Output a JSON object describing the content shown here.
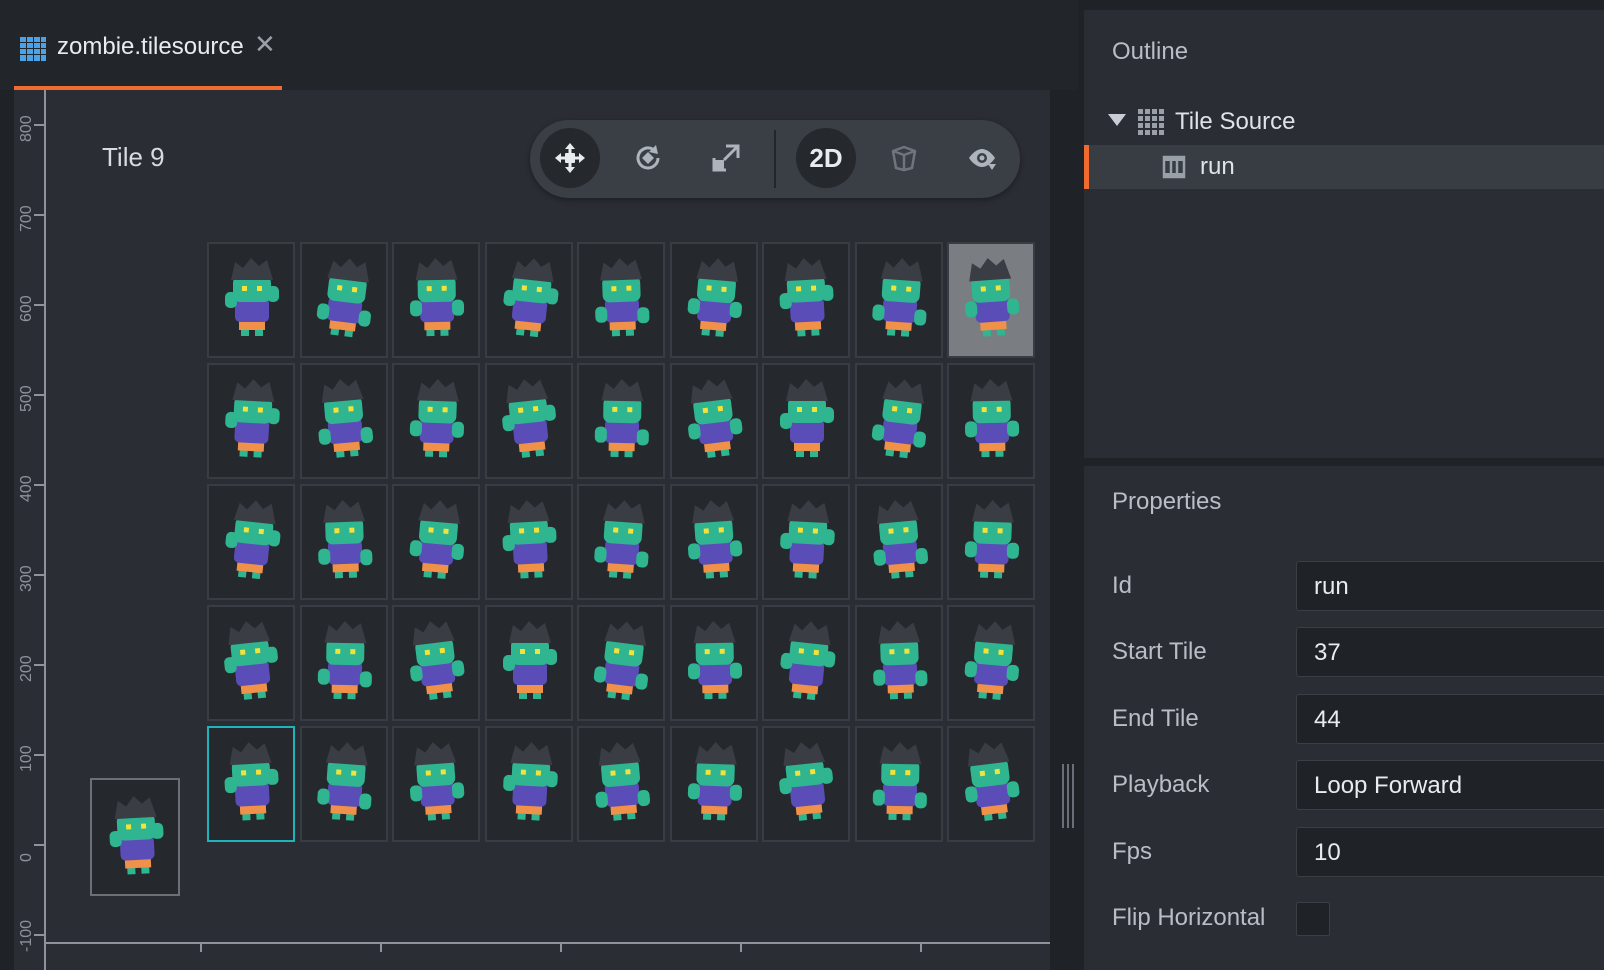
{
  "tab": {
    "title": "zombie.tilesource",
    "icon": "grid-icon"
  },
  "scene": {
    "tile_label": "Tile 9",
    "ruler_ticks": [
      "800",
      "700",
      "600",
      "500",
      "400",
      "300",
      "200",
      "100",
      "0",
      "-100"
    ],
    "toolbar": {
      "mode_2d_label": "2D",
      "tools": [
        "move-icon",
        "rotate-icon",
        "scale-icon",
        "2d-toggle",
        "perspective-cube-icon",
        "visibility-filter-icon"
      ]
    },
    "grid": {
      "rows": 5,
      "cols": 9,
      "hover_tile": 9,
      "selected_tile": 37
    }
  },
  "outline": {
    "title": "Outline",
    "root": {
      "label": "Tile Source",
      "icon": "tilesource-grid-icon"
    },
    "child": {
      "label": "run",
      "icon": "animation-filmstrip-icon"
    }
  },
  "properties": {
    "title": "Properties",
    "fields": [
      {
        "label": "Id",
        "value": "run"
      },
      {
        "label": "Start Tile",
        "value": "37"
      },
      {
        "label": "End Tile",
        "value": "44"
      },
      {
        "label": "Playback",
        "value": "Loop Forward"
      },
      {
        "label": "Fps",
        "value": "10"
      }
    ],
    "flip_horizontal": {
      "label": "Flip Horizontal",
      "checked": false
    }
  },
  "colors": {
    "accent": "#f16b30",
    "selection": "#1fb5b8",
    "zombie_skin": "#2fb58f",
    "zombie_shirt": "#5a4db8",
    "zombie_pants": "#f0914a",
    "zombie_hair": "#3a3d44"
  }
}
